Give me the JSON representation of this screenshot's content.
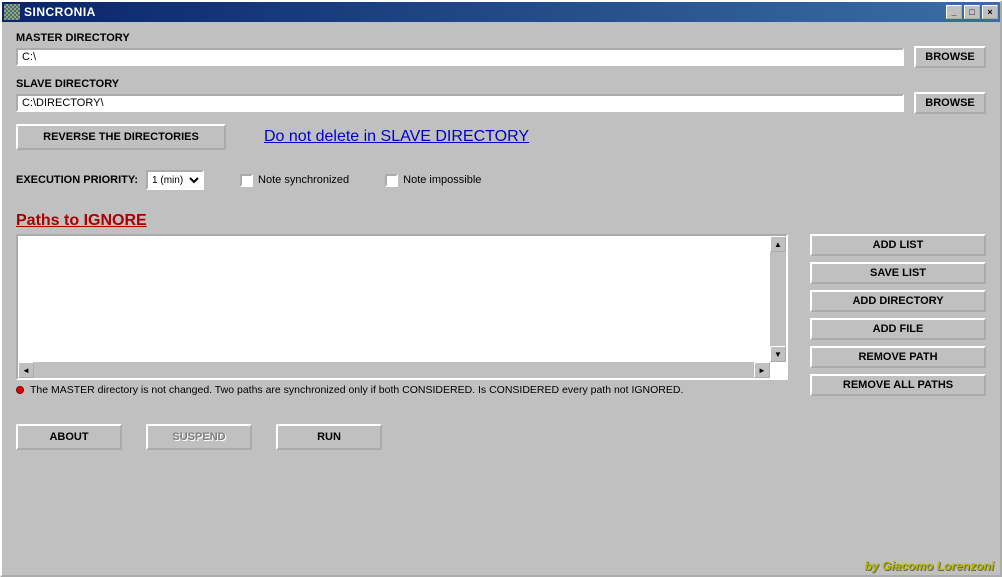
{
  "titlebar": {
    "title": "SINCRONIA"
  },
  "master": {
    "label": "MASTER DIRECTORY",
    "value": "C:\\",
    "browse": "BROWSE"
  },
  "slave": {
    "label": "SLAVE DIRECTORY",
    "value": "C:\\DIRECTORY\\",
    "browse": "BROWSE"
  },
  "reverse_btn": "REVERSE THE DIRECTORIES",
  "delete_link": "Do not delete in SLAVE DIRECTORY",
  "exec": {
    "label": "EXECUTION PRIORITY:",
    "selected": "1 (min)"
  },
  "check_sync": "Note synchronized",
  "check_imp": "Note impossible",
  "paths_header": "Paths to IGNORE",
  "side": {
    "add_list": "ADD LIST",
    "save_list": "SAVE LIST",
    "add_dir": "ADD DIRECTORY",
    "add_file": "ADD FILE",
    "remove_path": "REMOVE PATH",
    "remove_all": "REMOVE ALL PATHS"
  },
  "status_text": "The MASTER directory is not changed. Two paths are synchronized only if both CONSIDERED.  Is CONSIDERED every path not IGNORED.",
  "bottom": {
    "about": "ABOUT",
    "suspend": "SUSPEND",
    "run": "RUN"
  },
  "credit": "by Giacomo Lorenzoni"
}
